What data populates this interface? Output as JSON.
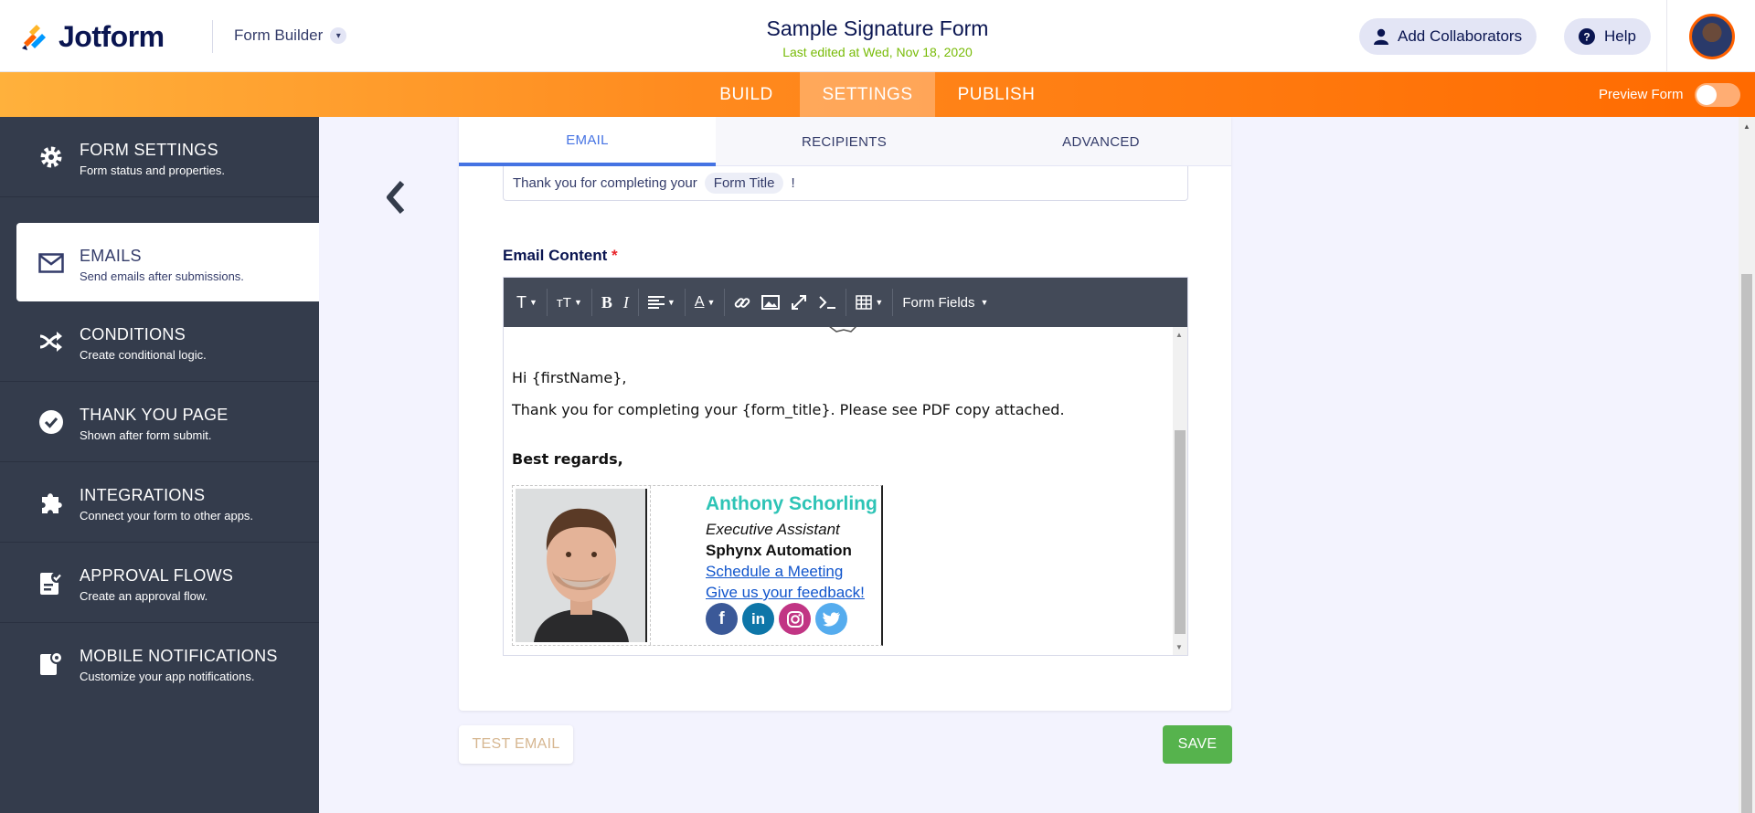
{
  "header": {
    "logo_text": "Jotform",
    "builder_label": "Form Builder",
    "form_title": "Sample Signature Form",
    "last_edited": "Last edited at Wed, Nov 18, 2020",
    "collaborators_label": "Add Collaborators",
    "help_label": "Help"
  },
  "nav": {
    "build": "BUILD",
    "settings": "SETTINGS",
    "publish": "PUBLISH",
    "preview_label": "Preview Form",
    "preview_on": false
  },
  "sidebar": {
    "items": [
      {
        "title": "FORM SETTINGS",
        "sub": "Form status and properties.",
        "icon": "gear-icon"
      },
      {
        "title": "EMAILS",
        "sub": "Send emails after submissions.",
        "icon": "envelope-icon"
      },
      {
        "title": "CONDITIONS",
        "sub": "Create conditional logic.",
        "icon": "shuffle-icon"
      },
      {
        "title": "THANK YOU PAGE",
        "sub": "Shown after form submit.",
        "icon": "check-circle-icon"
      },
      {
        "title": "INTEGRATIONS",
        "sub": "Connect your form to other apps.",
        "icon": "puzzle-icon"
      },
      {
        "title": "APPROVAL FLOWS",
        "sub": "Create an approval flow.",
        "icon": "approval-icon"
      },
      {
        "title": "MOBILE NOTIFICATIONS",
        "sub": "Customize your app notifications.",
        "icon": "mobile-notification-icon"
      }
    ],
    "active_index": 1
  },
  "panel": {
    "tabs": [
      "EMAIL",
      "RECIPIENTS",
      "ADVANCED"
    ],
    "active_tab": 0,
    "subject_prefix": "Thank you for completing your",
    "subject_chip": "Form Title",
    "subject_suffix": "!",
    "content_label": "Email Content",
    "required_mark": "*",
    "form_fields_label": "Form Fields"
  },
  "email_body": {
    "greeting": "Hi {firstName},",
    "line": "Thank you for completing your {form_title}. Please see PDF copy attached.",
    "closing": "Best regards,",
    "signature": {
      "name": "Anthony Schorling",
      "role": "Executive Assistant",
      "company": "Sphynx Automation",
      "link1": "Schedule a Meeting",
      "link2": "Give us your feedback!",
      "socials": [
        "f",
        "in",
        "◎",
        "🐦"
      ]
    }
  },
  "actions": {
    "test_email": "TEST EMAIL",
    "save": "SAVE"
  },
  "colors": {
    "accent_orange": "#ff6100",
    "tab_blue": "#4573e3",
    "save_green": "#56b34d",
    "sig_name": "#2ec4b6",
    "link_blue": "#1155cc"
  }
}
